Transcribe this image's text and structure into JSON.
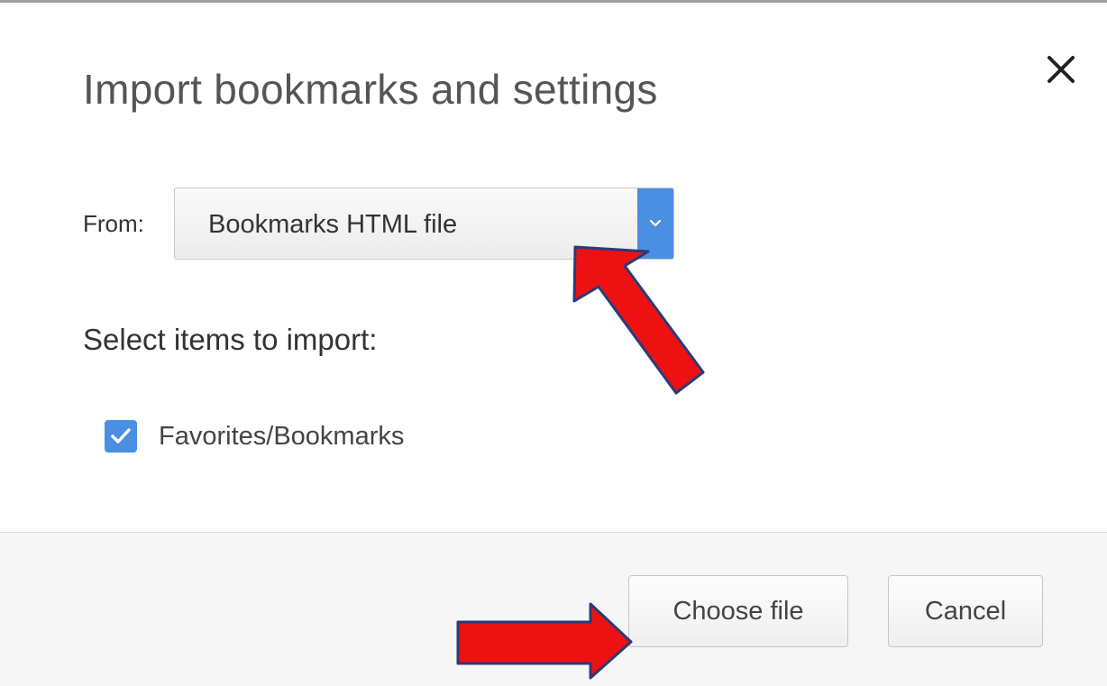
{
  "dialog": {
    "title": "Import bookmarks and settings",
    "close_icon": "close-icon"
  },
  "from": {
    "label": "From:",
    "selected": "Bookmarks HTML file",
    "arrow_icon": "chevron-down-icon"
  },
  "items": {
    "heading": "Select items to import:",
    "options": [
      {
        "label": "Favorites/Bookmarks",
        "checked": true
      }
    ]
  },
  "footer": {
    "choose_file": "Choose file",
    "cancel": "Cancel"
  },
  "colors": {
    "accent": "#4b8fe2",
    "annotation_arrow": "#ee1111",
    "annotation_outline": "#2a3a7a"
  }
}
